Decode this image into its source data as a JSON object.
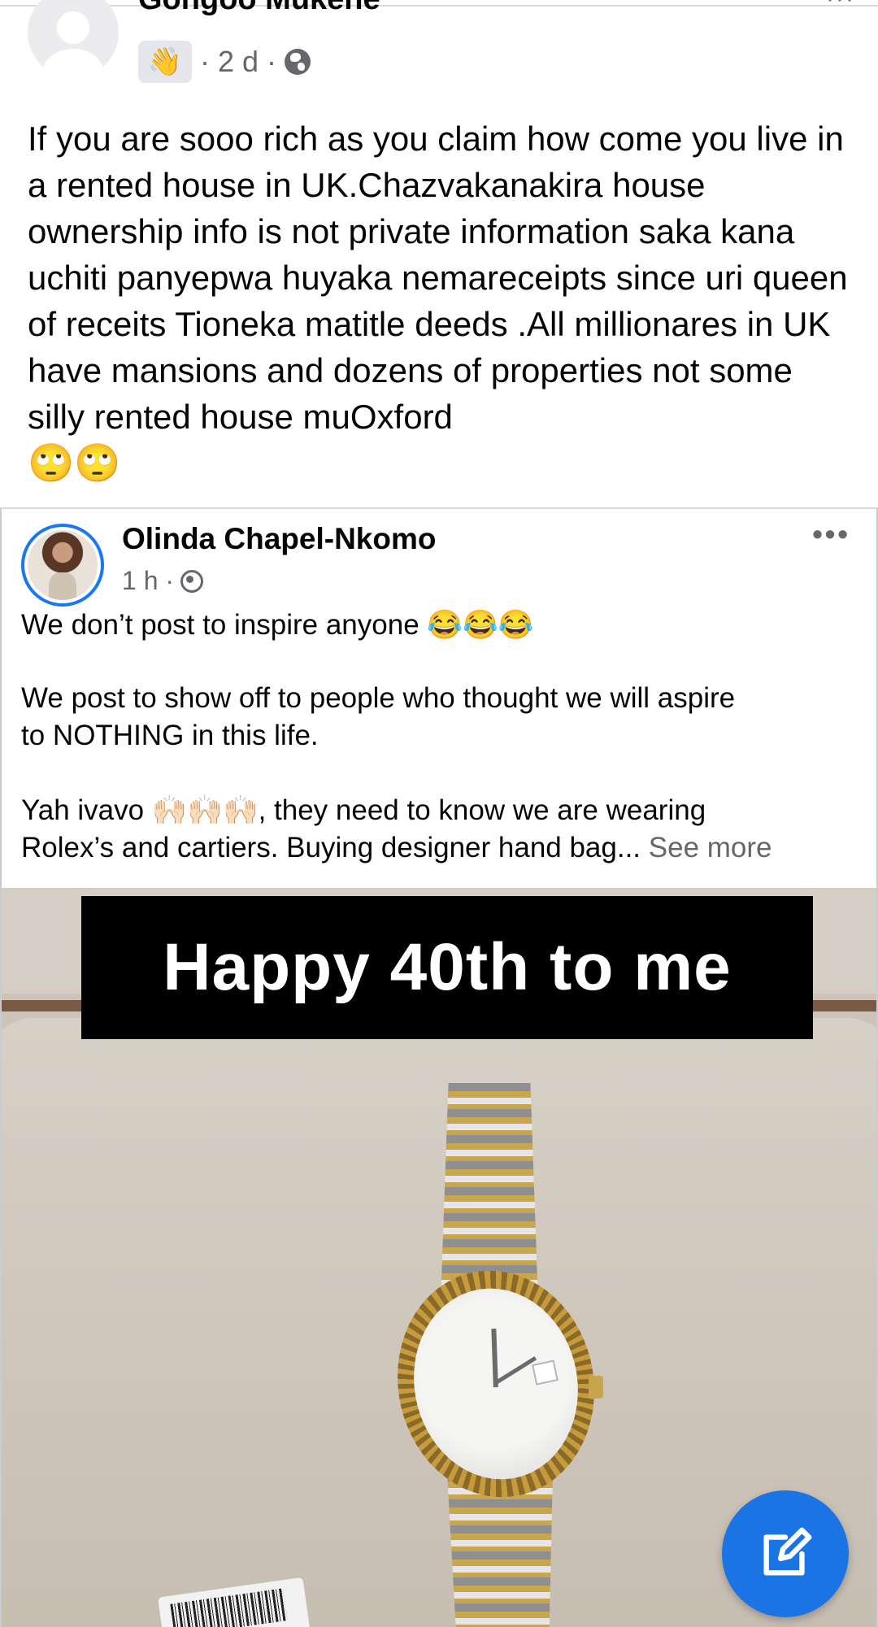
{
  "comment": {
    "author_name": "Gongoo Mukene",
    "badge_icon": "waving-hand-icon",
    "badge_glyph": "👋",
    "meta_time": "· 2 d ·",
    "more_label": "···",
    "text": "If you are sooo rich as you claim how come you live in a rented house in UK.Chazvakanakira house ownership info is not private information saka kana uchiti panyepwa huyaka nemareceipts since uri queen of receits Tioneka matitle deeds .All millionares in UK have mansions and dozens of properties not some silly rented house muOxford",
    "emoji": "🙄🙄"
  },
  "shared_post": {
    "author_name": "Olinda Chapel-Nkomo",
    "time": "1 h ·",
    "more_label": "•••",
    "lines": [
      "We don’t post to inspire anyone 😂😂😂",
      "We post to show off to people who thought we will aspire",
      "to NOTHING in this life.",
      "Yah ivavo 🙌🏻🙌🏻🙌🏻, they need to know we are wearing",
      "Rolex’s and cartiers. Buying designer hand bag..."
    ],
    "see_more": "See more",
    "photo_banner": "Happy 40th to me"
  },
  "fab": {
    "icon": "compose-icon",
    "color": "#1b74e4"
  }
}
